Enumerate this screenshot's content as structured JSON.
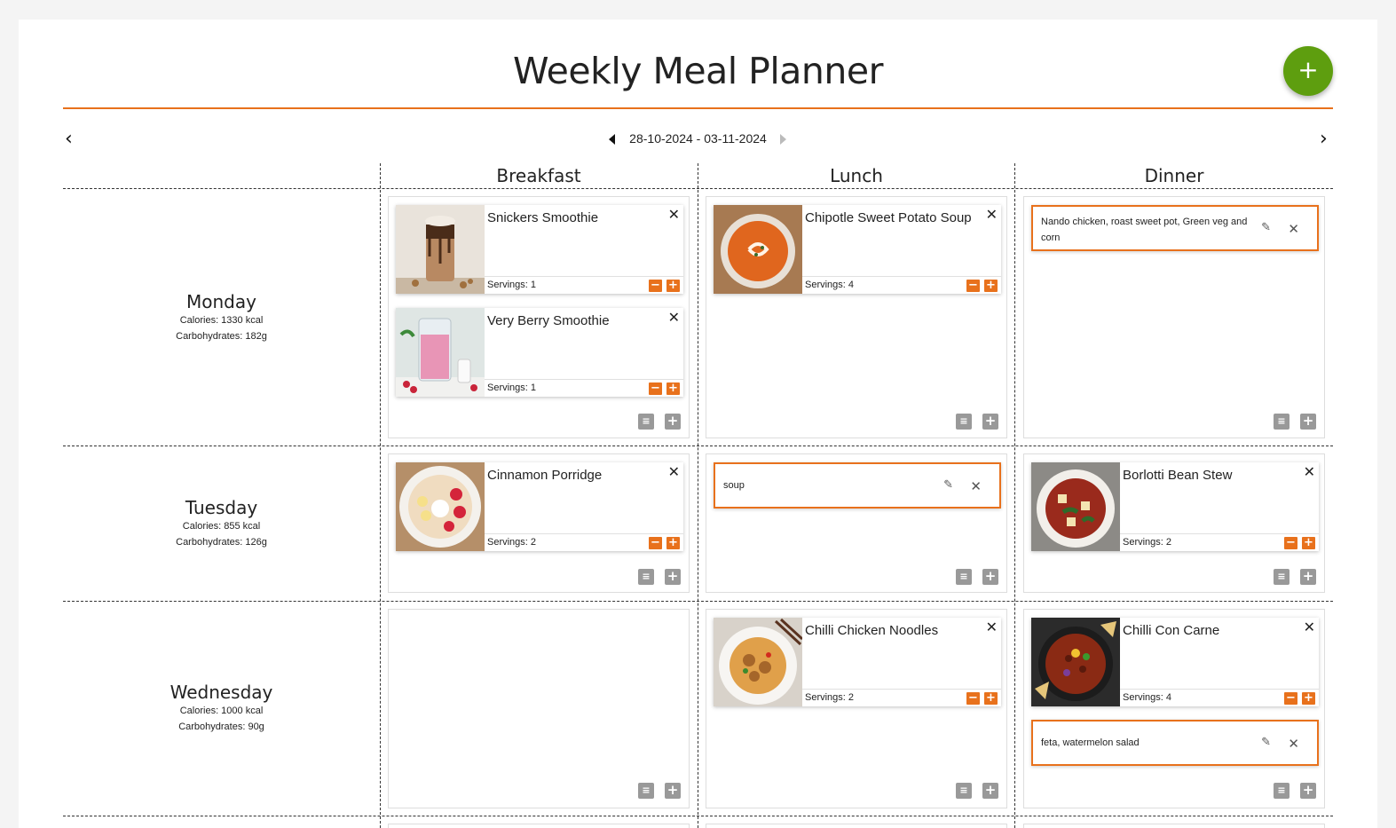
{
  "header": {
    "title": "Weekly Meal Planner",
    "add_label": "+"
  },
  "nav": {
    "prev_label": "‹",
    "next_label": "›",
    "date_range": "28-10-2024 - 03-11-2024"
  },
  "columns": [
    "Breakfast",
    "Lunch",
    "Dinner"
  ],
  "days": [
    {
      "name": "Monday",
      "calories": "Calories: 1330 kcal",
      "carbs": "Carbohydrates: 182g"
    },
    {
      "name": "Tuesday",
      "calories": "Calories: 855 kcal",
      "carbs": "Carbohydrates: 126g"
    },
    {
      "name": "Wednesday",
      "calories": "Calories: 1000 kcal",
      "carbs": "Carbohydrates: 90g"
    }
  ],
  "recipes": {
    "snickers": {
      "title": "Snickers Smoothie",
      "servings": "Servings: 1"
    },
    "berry": {
      "title": "Very Berry Smoothie",
      "servings": "Servings: 1"
    },
    "chipotle": {
      "title": "Chipotle Sweet Potato Soup",
      "servings": "Servings: 4"
    },
    "porridge": {
      "title": "Cinnamon Porridge",
      "servings": "Servings: 2"
    },
    "borlotti": {
      "title": "Borlotti Bean Stew",
      "servings": "Servings: 2"
    },
    "noodles": {
      "title": "Chilli Chicken Noodles",
      "servings": "Servings: 2"
    },
    "chilli": {
      "title": "Chilli Con Carne",
      "servings": "Servings: 4"
    }
  },
  "notes": {
    "nando": "Nando chicken, roast sweet pot, Green veg and corn",
    "soup": "soup",
    "feta": "feta, watermelon salad"
  },
  "icons": {
    "close": "close-icon",
    "edit": "pencil-icon",
    "minus": "minus-icon",
    "plus": "plus-icon",
    "note": "note-icon"
  },
  "colors": {
    "accent": "#e8711c",
    "fab": "#5e9e0f"
  }
}
